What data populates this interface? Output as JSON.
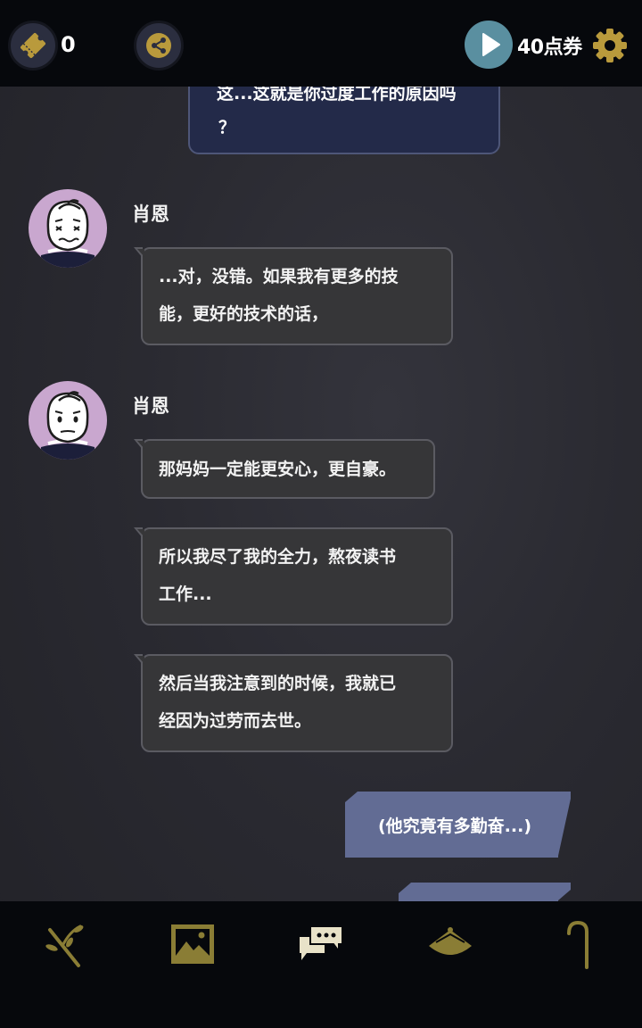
{
  "topbar": {
    "ticket_count": "0",
    "points_label": "40点券",
    "icons": [
      "ticket-icon",
      "share-icon",
      "play-icon",
      "gear-icon"
    ]
  },
  "chat": {
    "previous_bubble": {
      "line1": "这...这就是你过度工作的原因吗",
      "line2": "？"
    },
    "groups": [
      {
        "speaker": "肖恩",
        "expression": "worried",
        "messages": [
          {
            "lines": [
              "...对，没错。如果我有更多的技",
              "能，更好的技术的话，"
            ]
          }
        ]
      },
      {
        "speaker": "肖恩",
        "expression": "calm",
        "messages": [
          {
            "lines": [
              "那妈妈一定能更安心，更自豪。"
            ]
          },
          {
            "lines": [
              "所以我尽了我的全力，熬夜读书",
              "工作..."
            ]
          },
          {
            "lines": [
              "然后当我注意到的时候，我就已",
              "经因为过劳而去世。"
            ]
          }
        ]
      }
    ],
    "player_messages": [
      {
        "text": "(他究竟有多勤奋...)"
      },
      {
        "text": ""
      }
    ]
  },
  "bottom_nav": {
    "items": [
      "branch-icon",
      "gallery-icon",
      "chat-icon",
      "hat-icon",
      "cane-icon"
    ],
    "active": "chat-icon",
    "colors": {
      "inactive": "#8a7d35",
      "active": "#e8e2c8"
    }
  },
  "colors": {
    "npc_bubble": "#363638",
    "player_bubble": "#626c94",
    "avatar_bg": "#c9a7cf",
    "play_button": "#5a8fa0",
    "gear": "#b99a3c"
  }
}
